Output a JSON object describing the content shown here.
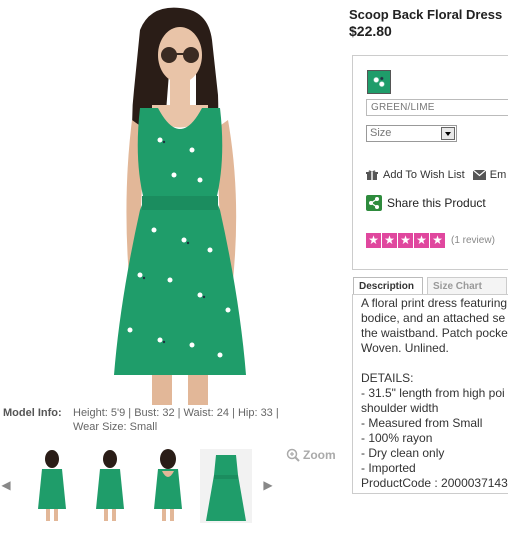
{
  "product": {
    "title": "Scoop Back Floral Dress",
    "price": "$22.80",
    "color_value": "GREEN/LIME",
    "size_selected": "Size",
    "add_to_wishlist": "Add To Wish List",
    "email_partial": "Em",
    "share": "Share this Product",
    "review_count": "(1 review)",
    "rating_stars": 5
  },
  "model": {
    "label": "Model Info:",
    "text": "Height: 5'9 | Bust: 32 | Waist: 24 | Hip: 33 | Wear Size: Small"
  },
  "gallery": {
    "zoom_label": "Zoom",
    "thumbnails": [
      "front-view",
      "front-view-2",
      "back-view",
      "flat-view"
    ]
  },
  "tabs": {
    "description": "Description",
    "size_chart": "Size Chart"
  },
  "description_lines": [
    "A floral print dress featuring",
    "bodice, and an attached se",
    "the waistband. Patch pocke",
    "Woven. Unlined.",
    "",
    "DETAILS:",
    "- 31.5\" length from high poi",
    "shoulder width",
    "- Measured from Small",
    "- 100% rayon",
    "- Dry clean only",
    "- Imported",
    "ProductCode : 2000037143"
  ],
  "colors": {
    "dress_green": "#1f9d6a",
    "rating_pink": "#e0479e",
    "share_green": "#2e8b3d"
  }
}
